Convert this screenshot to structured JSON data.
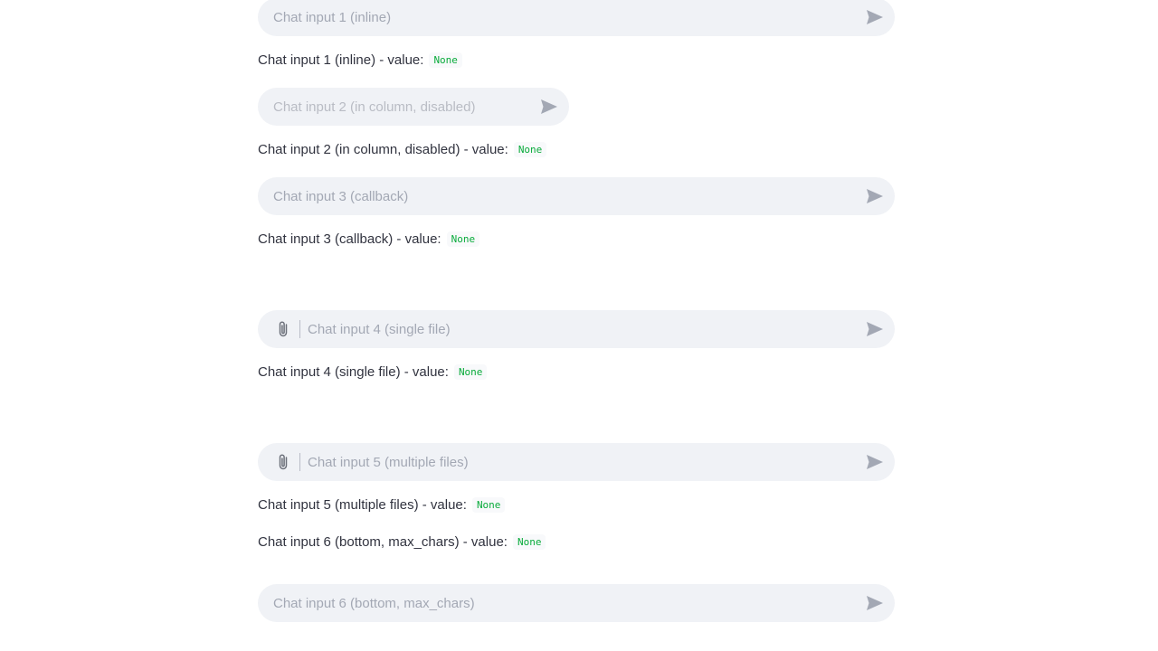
{
  "inputs": [
    {
      "placeholder": "Chat input 1 (inline)",
      "value_label": "Chat input 1 (inline) - value:",
      "value": "None"
    },
    {
      "placeholder": "Chat input 2 (in column, disabled)",
      "value_label": "Chat input 2 (in column, disabled) - value:",
      "value": "None"
    },
    {
      "placeholder": "Chat input 3 (callback)",
      "value_label": "Chat input 3 (callback) - value:",
      "value": "None"
    },
    {
      "placeholder": "Chat input 4 (single file)",
      "value_label": "Chat input 4 (single file) - value:",
      "value": "None"
    },
    {
      "placeholder": "Chat input 5 (multiple files)",
      "value_label": "Chat input 5 (multiple files) - value:",
      "value": "None"
    },
    {
      "placeholder": "Chat input 6 (bottom, max_chars)",
      "value_label": "Chat input 6 (bottom, max_chars) - value:",
      "value": "None"
    }
  ],
  "icons": {
    "send": "send-icon",
    "attach": "paperclip-icon"
  },
  "colors": {
    "input_bg": "#f0f2f6",
    "placeholder": "#a3a8b4",
    "value_code": "#09ab3b",
    "text": "#31333f",
    "icon": "#a3a8b4"
  }
}
